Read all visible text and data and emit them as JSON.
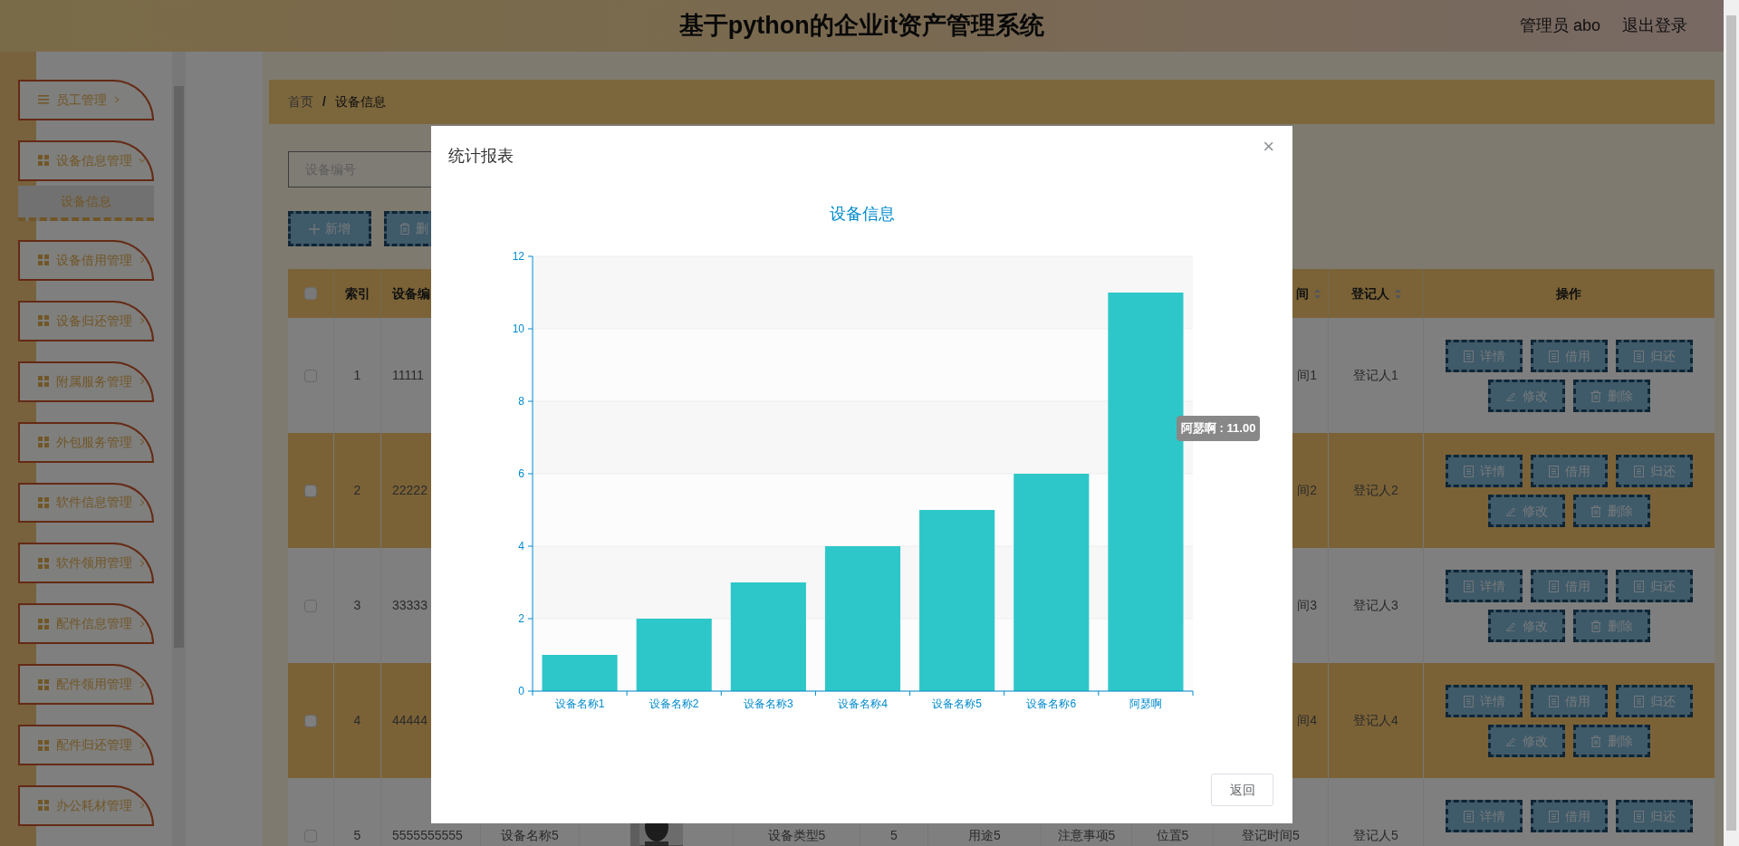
{
  "header": {
    "title": "基于python的企业it资产管理系统",
    "user": "管理员 abo",
    "logout": "退出登录"
  },
  "sidebar": {
    "items": [
      {
        "label": "员工管理",
        "expanded": false
      },
      {
        "label": "设备信息管理",
        "expanded": true,
        "children": [
          {
            "label": "设备信息",
            "selected": true
          }
        ]
      },
      {
        "label": "设备借用管理",
        "expanded": false
      },
      {
        "label": "设备归还管理",
        "expanded": false
      },
      {
        "label": "附属服务管理",
        "expanded": false
      },
      {
        "label": "外包服务管理",
        "expanded": false
      },
      {
        "label": "软件信息管理",
        "expanded": false
      },
      {
        "label": "软件领用管理",
        "expanded": false
      },
      {
        "label": "配件信息管理",
        "expanded": false
      },
      {
        "label": "配件领用管理",
        "expanded": false
      },
      {
        "label": "配件归还管理",
        "expanded": false
      },
      {
        "label": "办公耗材管理",
        "expanded": false
      }
    ]
  },
  "breadcrumb": {
    "items": [
      "首页",
      "设备信息"
    ],
    "separator": "/"
  },
  "search": {
    "placeholder": "设备编号"
  },
  "toolbar": [
    {
      "kind": "add",
      "label": "新增"
    },
    {
      "kind": "delete",
      "label": "删"
    }
  ],
  "table": {
    "all_checked": false,
    "columns": [
      {
        "kind": "index",
        "label": "索引"
      },
      {
        "kind": "code",
        "label": "设备编"
      },
      {
        "kind": "time",
        "label": "间",
        "sortable": true
      },
      {
        "kind": "registrar",
        "label": "登记人",
        "sortable": true
      },
      {
        "kind": "actions",
        "label": "操作"
      }
    ],
    "rows": [
      {
        "checked": false,
        "index": "1",
        "code": "11111",
        "time": "间1",
        "registrar": "登记人1",
        "actions": [
          {
            "kind": "doc",
            "label": "详情"
          },
          {
            "kind": "doc",
            "label": "借用"
          },
          {
            "kind": "doc",
            "label": "归还"
          },
          {
            "kind": "edit",
            "label": "修改"
          },
          {
            "kind": "delete",
            "label": "删除"
          }
        ]
      },
      {
        "checked": false,
        "index": "2",
        "code": "22222",
        "time": "间2",
        "registrar": "登记人2",
        "actions": [
          {
            "kind": "doc",
            "label": "详情"
          },
          {
            "kind": "doc",
            "label": "借用"
          },
          {
            "kind": "doc",
            "label": "归还"
          },
          {
            "kind": "edit",
            "label": "修改"
          },
          {
            "kind": "delete",
            "label": "删除"
          }
        ]
      },
      {
        "checked": false,
        "index": "3",
        "code": "33333",
        "time": "间3",
        "registrar": "登记人3",
        "actions": [
          {
            "kind": "doc",
            "label": "详情"
          },
          {
            "kind": "doc",
            "label": "借用"
          },
          {
            "kind": "doc",
            "label": "归还"
          },
          {
            "kind": "edit",
            "label": "修改"
          },
          {
            "kind": "delete",
            "label": "删除"
          }
        ]
      },
      {
        "checked": false,
        "index": "4",
        "code": "44444",
        "time": "间4",
        "registrar": "登记人4",
        "actions": [
          {
            "kind": "doc",
            "label": "详情"
          },
          {
            "kind": "doc",
            "label": "借用"
          },
          {
            "kind": "doc",
            "label": "归还"
          },
          {
            "kind": "edit",
            "label": "修改"
          },
          {
            "kind": "delete",
            "label": "删除"
          }
        ]
      },
      {
        "checked": false,
        "index": "5",
        "code": "5555555555",
        "name": "设备名称5",
        "type": "设备类型5",
        "count": "5",
        "use": "用途5",
        "notes": "注意事项5",
        "location": "位置5",
        "time": "登记时间5",
        "registrar": "登记人5",
        "actions": [
          {
            "kind": "doc",
            "label": "详情"
          },
          {
            "kind": "doc",
            "label": "借用"
          },
          {
            "kind": "doc",
            "label": "归还"
          }
        ]
      }
    ]
  },
  "modal": {
    "title": "统计报表",
    "close": "×",
    "tooltip": "阿瑟啊 : 11.00",
    "buttons": [
      "返回"
    ],
    "chart_data": {
      "type": "bar",
      "title": "设备信息",
      "categories": [
        "设备名称1",
        "设备名称2",
        "设备名称3",
        "设备名称4",
        "设备名称5",
        "设备名称6",
        "阿瑟啊"
      ],
      "series": [
        {
          "color": "#2ec7c9",
          "values": [
            1,
            2,
            3,
            4,
            5,
            6,
            11
          ]
        }
      ],
      "grid": true,
      "ylim": [
        0,
        12
      ],
      "yticks": [
        0,
        2,
        4,
        6,
        8,
        10,
        12
      ]
    }
  }
}
